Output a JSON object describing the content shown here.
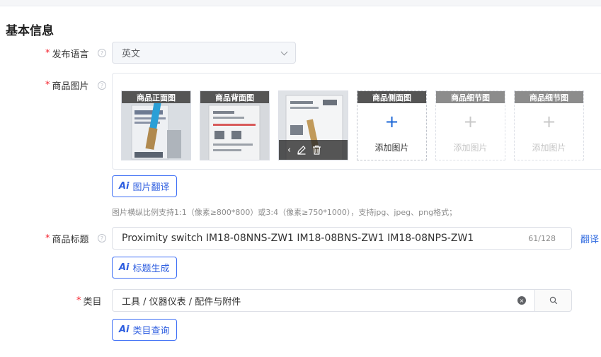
{
  "section_title": "基本信息",
  "fields": {
    "language": {
      "label": "发布语言",
      "value": "英文"
    },
    "images": {
      "label": "商品图片",
      "slots": [
        {
          "caption": "商品正面图",
          "filled": true
        },
        {
          "caption": "商品背面图",
          "filled": true
        },
        {
          "caption": "",
          "filled": true
        },
        {
          "caption": "商品侧面图",
          "filled": false,
          "add_label": "添加图片"
        },
        {
          "caption": "商品细节图",
          "filled": false,
          "add_label": "添加图片"
        },
        {
          "caption": "商品细节图",
          "filled": false,
          "add_label": "添加图片"
        }
      ],
      "ai_button": "图片翻译",
      "hint": "图片横纵比例支持1:1（像素≥800*800）或3:4（像素≥750*1000），支持jpg、jpeg、png格式；"
    },
    "title": {
      "label": "商品标题",
      "value": "Proximity switch IM18-08NNS-ZW1 IM18-08BNS-ZW1 IM18-08NPS-ZW1",
      "count": "61/128",
      "translate": "翻译",
      "ai_button": "标题生成"
    },
    "category": {
      "label": "类目",
      "value": "工具 / 仪器仪表 / 配件与附件",
      "ai_button": "类目查询"
    }
  },
  "icons": {
    "ai": "Ai",
    "help": "?",
    "plus": "+",
    "clear": "×",
    "back": "‹"
  },
  "colors": {
    "primary": "#3e6ff5",
    "required": "#f5222d",
    "border": "#dcdfe6",
    "hint": "#8c8c8c"
  }
}
